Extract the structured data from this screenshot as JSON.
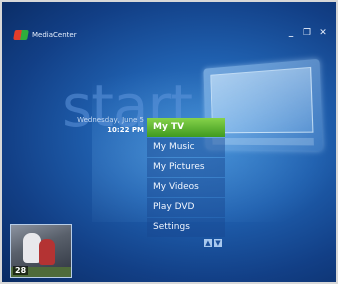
{
  "app": {
    "name": "MediaCenter"
  },
  "window_controls": {
    "minimize": "_",
    "restore": "❐",
    "close": "✕"
  },
  "start_word": "start",
  "datetime": {
    "date": "Wednesday, June 5",
    "time": "10:22 PM"
  },
  "menu": {
    "items": [
      {
        "label": "My TV",
        "selected": true
      },
      {
        "label": "My Music"
      },
      {
        "label": "My Pictures"
      },
      {
        "label": "My Videos"
      },
      {
        "label": "Play DVD"
      },
      {
        "label": "Settings"
      }
    ]
  },
  "scroll": {
    "up": "▲",
    "down": "▼"
  },
  "preview": {
    "channel": "28"
  }
}
